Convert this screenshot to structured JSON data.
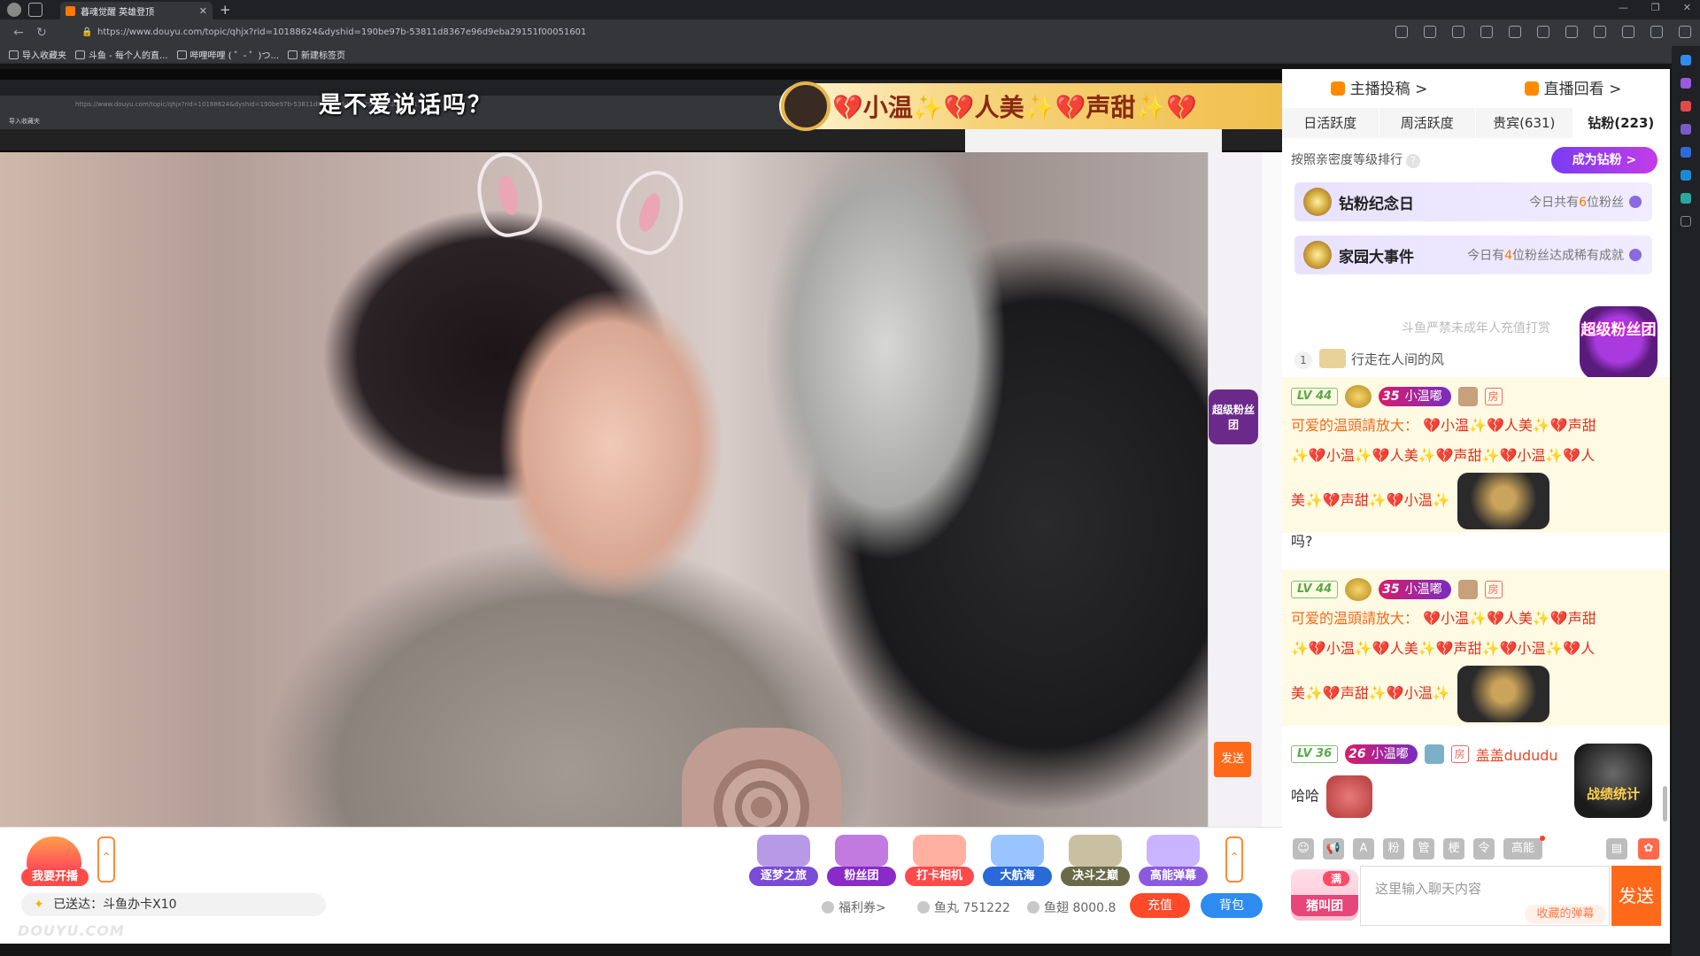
{
  "browser": {
    "tab_title": "暮魂觉醒 英雄登顶",
    "url": "https://www.douyu.com/topic/qhjx?rid=10188624&dyshid=190be97b-53811d8367e96d9eba29151f00051601",
    "bookmarks": [
      "导入收藏夹",
      "斗鱼 - 每个人的直...",
      "哔哩哔哩 ( ゜- ゜)つ...",
      "新建标签页"
    ]
  },
  "stream": {
    "overlay_title": "是不爱说话吗？",
    "marquee_text": "💔小温✨💔人美✨💔声甜✨💔",
    "inner_chat_send": "发送",
    "inner_super_fans": "超级粉丝团",
    "watermark": "DOUYU.COM"
  },
  "giftbar": {
    "go_live": "我要开播",
    "gifts": [
      {
        "label": "逐梦之旅",
        "color": "#7a4ad8"
      },
      {
        "label": "粉丝团",
        "color": "#8a2ac8"
      },
      {
        "label": "打卡相机",
        "color": "#ff4a4a"
      },
      {
        "label": "大航海",
        "color": "#2a6ad8"
      },
      {
        "label": "决斗之巅",
        "color": "#6a6a4a"
      },
      {
        "label": "高能弹幕",
        "color": "#8a5ae0"
      }
    ],
    "sent_text": "已送达：斗鱼办卡X10",
    "welfare": "福利券>",
    "yuwan": "鱼丸 751222",
    "yuchi": "鱼翅 8000.8",
    "recharge": "充值",
    "bag": "背包"
  },
  "panel": {
    "top_links": [
      "主播投稿 >",
      "直播回看 >"
    ],
    "tabs": [
      "日活跃度",
      "周活跃度",
      "贵宾(631)",
      "钻粉(223)"
    ],
    "sort_text": "按照亲密度等级排行",
    "become_fan": "成为钻粉 >",
    "banners": [
      {
        "name": "钻粉纪念日",
        "info_pre": "今日共有",
        "info_num": "6",
        "info_post": "位粉丝"
      },
      {
        "name": "家园大事件",
        "info_pre": "今日有",
        "info_num": "4",
        "info_post": "位粉丝达成稀有成就"
      }
    ],
    "minor_note": "斗鱼严禁未成年人充值打赏",
    "rank1_num": "1",
    "rank1_name": "行走在人间的风",
    "super_badge": "超级粉丝团",
    "battle_badge": "战绩统计"
  },
  "chat": {
    "messages": [
      {
        "level": "LV 44",
        "fan_level": "35",
        "fan_name": "小温嘟",
        "room": "房",
        "user": "可爱的温頭請放大：",
        "line1": "💔小温✨💔人美✨💔声甜",
        "line2": "✨💔小温✨💔人美✨💔声甜✨💔小温✨💔人",
        "line3": "美✨💔声甜✨💔小温✨"
      },
      {
        "level": "LV 44",
        "fan_level": "35",
        "fan_name": "小温嘟",
        "room": "房",
        "user": "可爱的温頭請放大：",
        "line1": "💔小温✨💔人美✨💔声甜",
        "line2": "✨💔小温✨💔人美✨💔声甜✨💔小温✨💔人",
        "line3": "美✨💔声甜✨💔小温✨"
      }
    ],
    "plain_line": "吗?",
    "last": {
      "level": "LV 36",
      "fan_level": "26",
      "fan_name": "小温嘟",
      "room": "房",
      "user": "盖盖dududu",
      "text_tail": "哈哈",
      "text_line2": "哈哈"
    }
  },
  "input": {
    "tools": [
      "粉",
      "管",
      "梗",
      "令"
    ],
    "high_energy": "高能",
    "fan_group_top": "满",
    "fan_group_bottom": "猪叫团",
    "placeholder": "这里输入聊天内容",
    "fav_danmu": "收藏的弹幕",
    "send": "发送"
  }
}
